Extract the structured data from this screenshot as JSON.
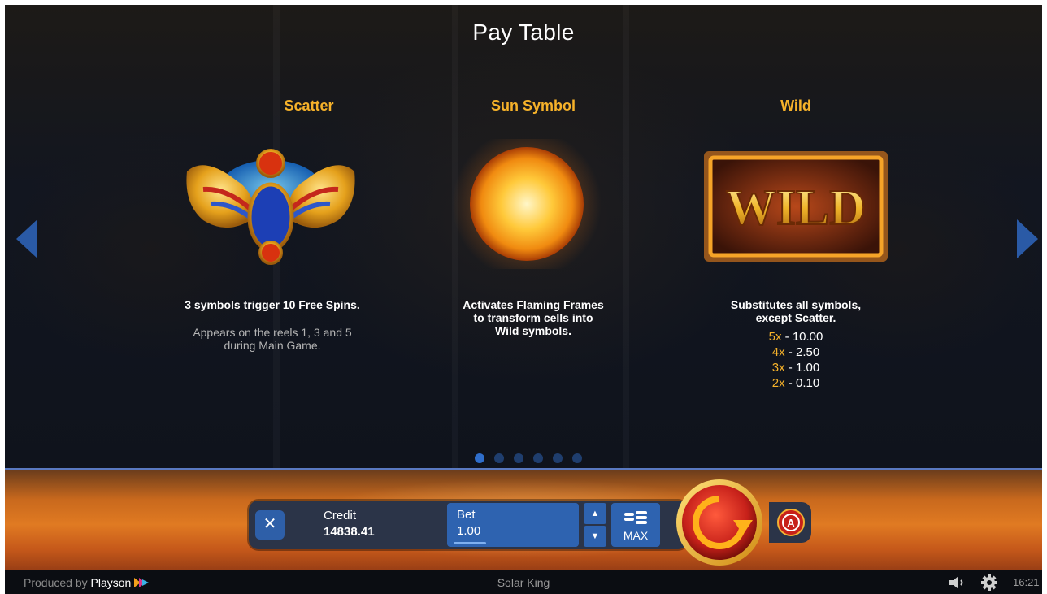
{
  "header": {
    "title": "Pay Table"
  },
  "columns": [
    {
      "title": "Scatter",
      "icon": "scarab-icon",
      "description": "3 symbols trigger 10 Free Spins.",
      "sub_lines": [
        "Appears on the reels 1, 3 and 5",
        "during Main Game."
      ]
    },
    {
      "title": "Sun Symbol",
      "icon": "sun-icon",
      "description_lines": [
        "Activates Flaming Frames",
        "to transform cells into",
        "Wild symbols."
      ]
    },
    {
      "title": "Wild",
      "icon": "wild-icon",
      "symbol_text": "WILD",
      "description_lines": [
        "Substitutes all symbols,",
        "except Scatter."
      ],
      "payouts": [
        {
          "mult": "5x",
          "value": "10.00"
        },
        {
          "mult": "4x",
          "value": "2.50"
        },
        {
          "mult": "3x",
          "value": "1.00"
        },
        {
          "mult": "2x",
          "value": "0.10"
        }
      ]
    }
  ],
  "pagination": {
    "pages": 6,
    "active": 0
  },
  "controls": {
    "credit_label": "Credit",
    "credit_value": "14838.41",
    "bet_label": "Bet",
    "bet_value": "1.00",
    "max_label": "MAX",
    "autoplay_letter": "A"
  },
  "footer": {
    "produced_by": "Produced by ",
    "brand": "Playson",
    "game_name": "Solar King",
    "time": "16:21"
  },
  "colors": {
    "accent_gold": "#f6b22a",
    "button_blue": "#2e63b0",
    "spin_red": "#c7211a"
  }
}
